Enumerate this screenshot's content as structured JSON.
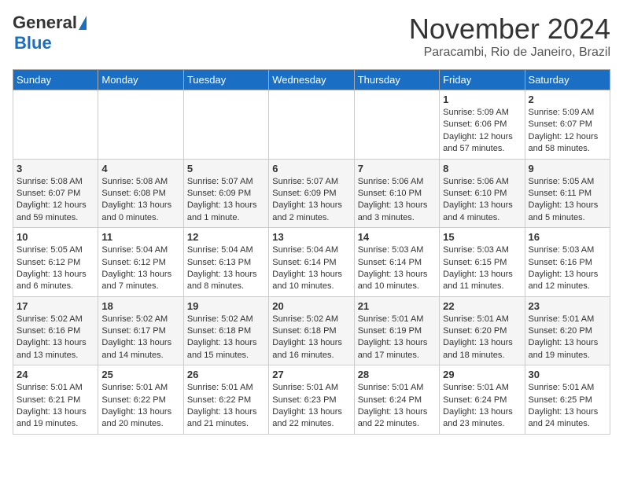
{
  "logo": {
    "general": "General",
    "blue": "Blue"
  },
  "title": "November 2024",
  "location": "Paracambi, Rio de Janeiro, Brazil",
  "days_of_week": [
    "Sunday",
    "Monday",
    "Tuesday",
    "Wednesday",
    "Thursday",
    "Friday",
    "Saturday"
  ],
  "weeks": [
    [
      {
        "day": "",
        "info": ""
      },
      {
        "day": "",
        "info": ""
      },
      {
        "day": "",
        "info": ""
      },
      {
        "day": "",
        "info": ""
      },
      {
        "day": "",
        "info": ""
      },
      {
        "day": "1",
        "info": "Sunrise: 5:09 AM\nSunset: 6:06 PM\nDaylight: 12 hours and 57 minutes."
      },
      {
        "day": "2",
        "info": "Sunrise: 5:09 AM\nSunset: 6:07 PM\nDaylight: 12 hours and 58 minutes."
      }
    ],
    [
      {
        "day": "3",
        "info": "Sunrise: 5:08 AM\nSunset: 6:07 PM\nDaylight: 12 hours and 59 minutes."
      },
      {
        "day": "4",
        "info": "Sunrise: 5:08 AM\nSunset: 6:08 PM\nDaylight: 13 hours and 0 minutes."
      },
      {
        "day": "5",
        "info": "Sunrise: 5:07 AM\nSunset: 6:09 PM\nDaylight: 13 hours and 1 minute."
      },
      {
        "day": "6",
        "info": "Sunrise: 5:07 AM\nSunset: 6:09 PM\nDaylight: 13 hours and 2 minutes."
      },
      {
        "day": "7",
        "info": "Sunrise: 5:06 AM\nSunset: 6:10 PM\nDaylight: 13 hours and 3 minutes."
      },
      {
        "day": "8",
        "info": "Sunrise: 5:06 AM\nSunset: 6:10 PM\nDaylight: 13 hours and 4 minutes."
      },
      {
        "day": "9",
        "info": "Sunrise: 5:05 AM\nSunset: 6:11 PM\nDaylight: 13 hours and 5 minutes."
      }
    ],
    [
      {
        "day": "10",
        "info": "Sunrise: 5:05 AM\nSunset: 6:12 PM\nDaylight: 13 hours and 6 minutes."
      },
      {
        "day": "11",
        "info": "Sunrise: 5:04 AM\nSunset: 6:12 PM\nDaylight: 13 hours and 7 minutes."
      },
      {
        "day": "12",
        "info": "Sunrise: 5:04 AM\nSunset: 6:13 PM\nDaylight: 13 hours and 8 minutes."
      },
      {
        "day": "13",
        "info": "Sunrise: 5:04 AM\nSunset: 6:14 PM\nDaylight: 13 hours and 10 minutes."
      },
      {
        "day": "14",
        "info": "Sunrise: 5:03 AM\nSunset: 6:14 PM\nDaylight: 13 hours and 10 minutes."
      },
      {
        "day": "15",
        "info": "Sunrise: 5:03 AM\nSunset: 6:15 PM\nDaylight: 13 hours and 11 minutes."
      },
      {
        "day": "16",
        "info": "Sunrise: 5:03 AM\nSunset: 6:16 PM\nDaylight: 13 hours and 12 minutes."
      }
    ],
    [
      {
        "day": "17",
        "info": "Sunrise: 5:02 AM\nSunset: 6:16 PM\nDaylight: 13 hours and 13 minutes."
      },
      {
        "day": "18",
        "info": "Sunrise: 5:02 AM\nSunset: 6:17 PM\nDaylight: 13 hours and 14 minutes."
      },
      {
        "day": "19",
        "info": "Sunrise: 5:02 AM\nSunset: 6:18 PM\nDaylight: 13 hours and 15 minutes."
      },
      {
        "day": "20",
        "info": "Sunrise: 5:02 AM\nSunset: 6:18 PM\nDaylight: 13 hours and 16 minutes."
      },
      {
        "day": "21",
        "info": "Sunrise: 5:01 AM\nSunset: 6:19 PM\nDaylight: 13 hours and 17 minutes."
      },
      {
        "day": "22",
        "info": "Sunrise: 5:01 AM\nSunset: 6:20 PM\nDaylight: 13 hours and 18 minutes."
      },
      {
        "day": "23",
        "info": "Sunrise: 5:01 AM\nSunset: 6:20 PM\nDaylight: 13 hours and 19 minutes."
      }
    ],
    [
      {
        "day": "24",
        "info": "Sunrise: 5:01 AM\nSunset: 6:21 PM\nDaylight: 13 hours and 19 minutes."
      },
      {
        "day": "25",
        "info": "Sunrise: 5:01 AM\nSunset: 6:22 PM\nDaylight: 13 hours and 20 minutes."
      },
      {
        "day": "26",
        "info": "Sunrise: 5:01 AM\nSunset: 6:22 PM\nDaylight: 13 hours and 21 minutes."
      },
      {
        "day": "27",
        "info": "Sunrise: 5:01 AM\nSunset: 6:23 PM\nDaylight: 13 hours and 22 minutes."
      },
      {
        "day": "28",
        "info": "Sunrise: 5:01 AM\nSunset: 6:24 PM\nDaylight: 13 hours and 22 minutes."
      },
      {
        "day": "29",
        "info": "Sunrise: 5:01 AM\nSunset: 6:24 PM\nDaylight: 13 hours and 23 minutes."
      },
      {
        "day": "30",
        "info": "Sunrise: 5:01 AM\nSunset: 6:25 PM\nDaylight: 13 hours and 24 minutes."
      }
    ]
  ]
}
